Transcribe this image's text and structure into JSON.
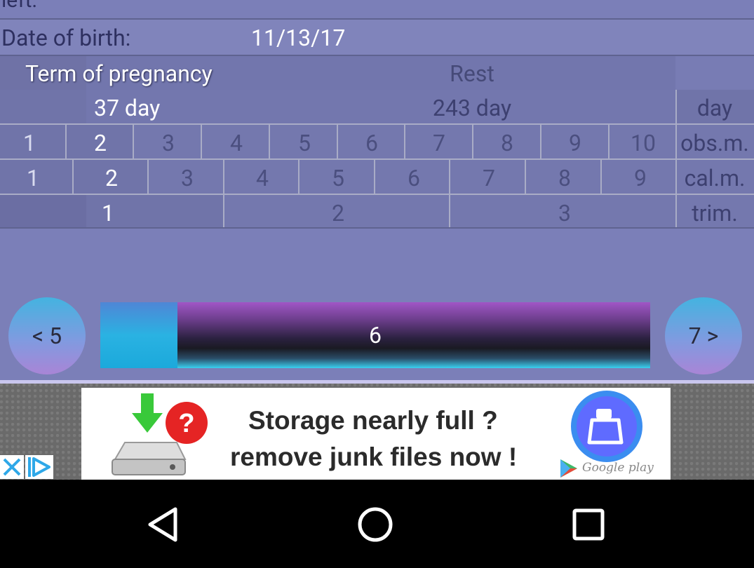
{
  "header": {
    "partial_label": "left:",
    "date_of_birth_label": "Date of birth:",
    "date_of_birth_value": "11/13/17"
  },
  "table": {
    "term_header": "Term of pregnancy",
    "rest_header": "Rest",
    "term_value": "37 day",
    "rest_value": "243 day",
    "unit_day": "day",
    "obs_months": [
      "1",
      "2",
      "3",
      "4",
      "5",
      "6",
      "7",
      "8",
      "9",
      "10"
    ],
    "obs_label": "obs.m.",
    "cal_months": [
      "1",
      "2",
      "3",
      "4",
      "5",
      "6",
      "7",
      "8",
      "9"
    ],
    "cal_label": "cal.m.",
    "trimesters": [
      "1",
      "2",
      "3"
    ],
    "trim_label": "trim."
  },
  "week_nav": {
    "prev_label": "< 5",
    "current": "6",
    "next_label": "7 >",
    "progress_fraction": 0.14
  },
  "ad": {
    "line1": "Storage nearly full ?",
    "line2": "remove junk files now !",
    "store": "Google play"
  },
  "colors": {
    "background": "#7b7fb8",
    "row_dark": "#6f72a6",
    "accent_cyan": "#2ab2e2",
    "accent_purple": "#a056c6"
  }
}
